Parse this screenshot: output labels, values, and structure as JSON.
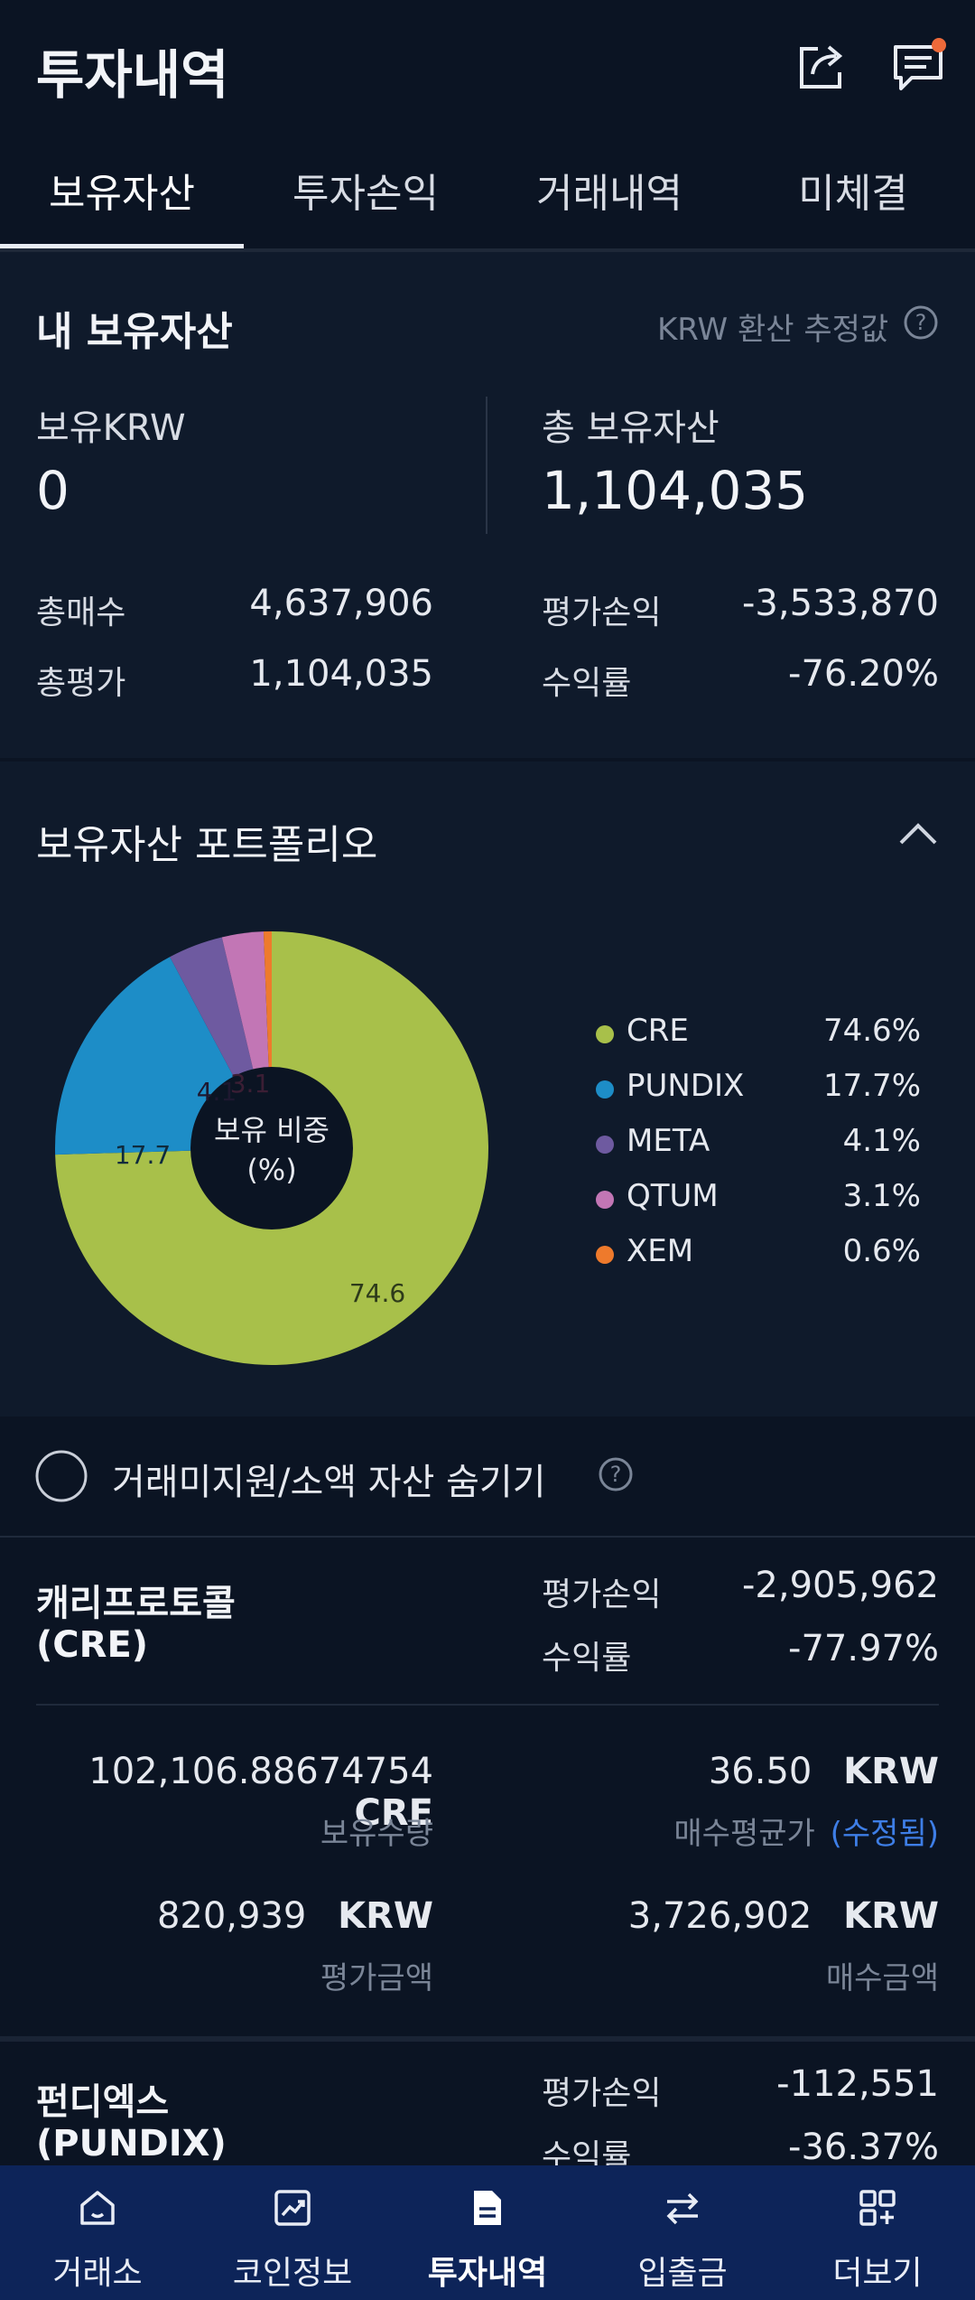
{
  "header": {
    "title": "투자내역",
    "share_icon": "share-icon",
    "chat_icon": "chat-notice-icon"
  },
  "tabs": [
    {
      "label": "보유자산"
    },
    {
      "label": "투자손익"
    },
    {
      "label": "거래내역"
    },
    {
      "label": "미체결"
    }
  ],
  "holdings": {
    "title": "내 보유자산",
    "note": "KRW 환산 추정값",
    "krw_label": "보유KRW",
    "krw_value": "0",
    "total_label": "총 보유자산",
    "total_value": "1,104,035",
    "buy_label": "총매수",
    "buy_value": "4,637,906",
    "eval_label": "총평가",
    "eval_value": "1,104,035",
    "pl_label": "평가손익",
    "pl_value": "-3,533,870",
    "rate_label": "수익률",
    "rate_value": "-76.20%"
  },
  "portfolio": {
    "title": "보유자산 포트폴리오",
    "center_line1": "보유 비중",
    "center_line2": "(%)",
    "slice_labels": {
      "cre": "74.6",
      "pundix": "17.7",
      "meta": "4.1",
      "qtum": "3.1"
    }
  },
  "chart_data": {
    "type": "pie",
    "title": "보유자산 포트폴리오",
    "categories": [
      "CRE",
      "PUNDIX",
      "META",
      "QTUM",
      "XEM"
    ],
    "values": [
      74.6,
      17.7,
      4.1,
      3.1,
      0.6
    ],
    "value_labels": [
      "74.6%",
      "17.7%",
      "4.1%",
      "3.1%",
      "0.6%"
    ],
    "colors": [
      "#a8c04a",
      "#1d8dc7",
      "#6e5aa0",
      "#c276b5",
      "#ee7a2c"
    ],
    "legend_position": "right",
    "donut": true
  },
  "hide_small": {
    "label": "거래미지원/소액 자산 숨기기"
  },
  "coin1": {
    "name_line1": "캐리프로토콜",
    "name_line2": "(CRE)",
    "pl_label": "평가손익",
    "pl_value": "-2,905,962",
    "rate_label": "수익률",
    "rate_value": "-77.97%",
    "qty_value": "102,106.88674754",
    "qty_unit": "CRE",
    "qty_label": "보유수량",
    "avg_value": "36.50",
    "avg_unit": "KRW",
    "avg_label": "매수평균가",
    "avg_edited": "(수정됨)",
    "eval_value": "820,939",
    "eval_unit": "KRW",
    "eval_label": "평가금액",
    "buy_value": "3,726,902",
    "buy_unit": "KRW",
    "buy_label": "매수금액"
  },
  "coin2": {
    "name_line1": "펀디엑스",
    "name_line2": "(PUNDIX)",
    "pl_label": "평가손익",
    "pl_value": "-112,551",
    "rate_label": "수익률",
    "rate_value": "-36.37%"
  },
  "nav": [
    {
      "label": "거래소",
      "icon": "home-icon"
    },
    {
      "label": "코인정보",
      "icon": "chart-icon"
    },
    {
      "label": "투자내역",
      "icon": "document-icon"
    },
    {
      "label": "입출금",
      "icon": "transfer-icon"
    },
    {
      "label": "더보기",
      "icon": "more-grid-icon"
    }
  ]
}
